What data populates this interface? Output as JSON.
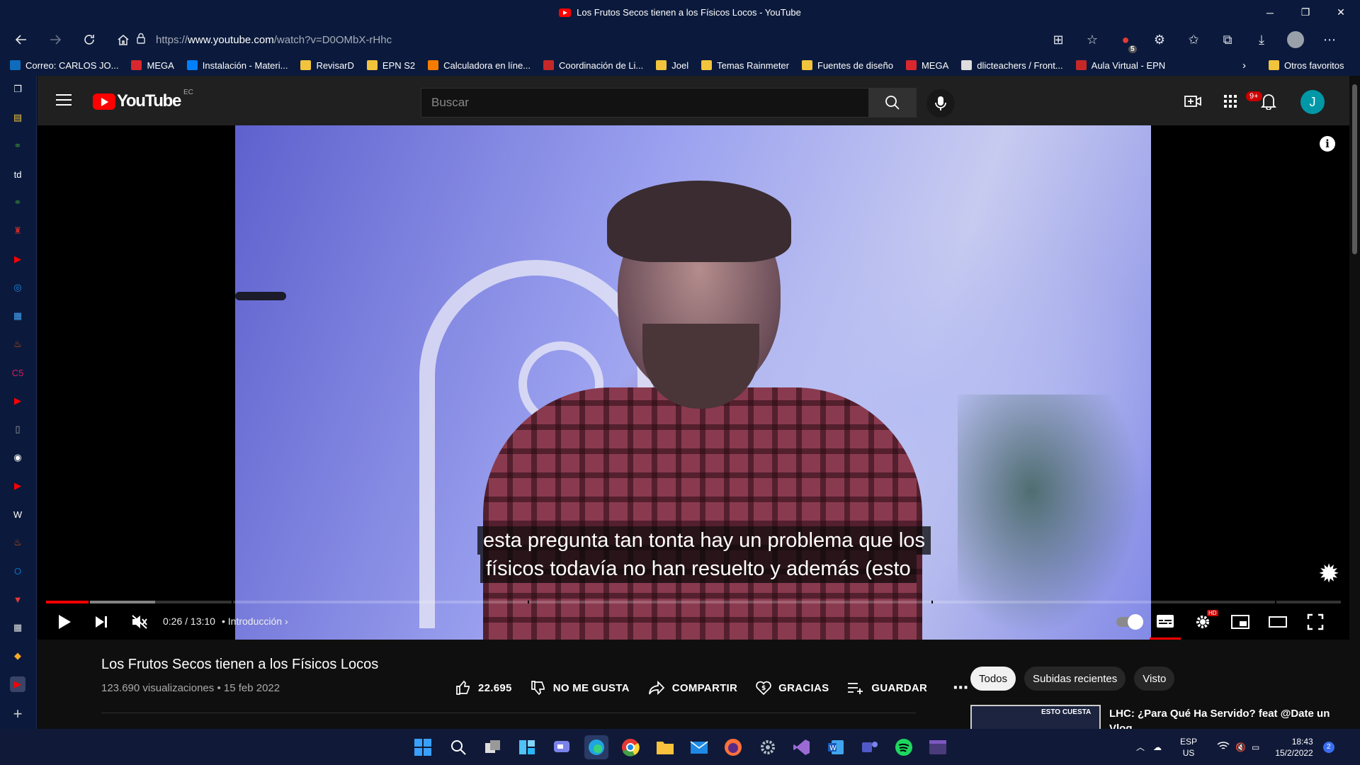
{
  "window": {
    "title": "Los Frutos Secos tienen a los Físicos Locos - YouTube",
    "controls": {
      "minimize": "─",
      "maximize": "❐",
      "close": "✕"
    }
  },
  "browser": {
    "url_prefix": "https://",
    "url_host": "www.youtube.com",
    "url_path": "/watch?v=D0OMbX-rHhc",
    "extension_badge": "5",
    "bookmarks": [
      {
        "label": "Correo: CARLOS JO...",
        "icon": "outlook-icon",
        "color": "#0f6cbd"
      },
      {
        "label": "MEGA",
        "icon": "mega-icon",
        "color": "#d9272e"
      },
      {
        "label": "Instalación - Materi...",
        "icon": "mui-icon",
        "color": "#007fff"
      },
      {
        "label": "RevisarD",
        "icon": "folder-icon",
        "color": "#f2c33d"
      },
      {
        "label": "EPN S2",
        "icon": "folder-icon",
        "color": "#f2c33d"
      },
      {
        "label": "Calculadora en líne...",
        "icon": "calculator-icon",
        "color": "#f57c00"
      },
      {
        "label": "Coordinación de Li...",
        "icon": "epn-icon",
        "color": "#c62828"
      },
      {
        "label": "Joel",
        "icon": "folder-icon",
        "color": "#f2c33d"
      },
      {
        "label": "Temas Rainmeter",
        "icon": "folder-icon",
        "color": "#f2c33d"
      },
      {
        "label": "Fuentes de diseño",
        "icon": "folder-icon",
        "color": "#f2c33d"
      },
      {
        "label": "MEGA",
        "icon": "mega-icon",
        "color": "#d9272e"
      },
      {
        "label": "dlicteachers / Front...",
        "icon": "pb-icon",
        "color": "#dddddd"
      },
      {
        "label": "Aula Virtual - EPN",
        "icon": "epn-icon",
        "color": "#c62828"
      }
    ],
    "other_favorites": "Otros favoritos"
  },
  "sidebar_icons": [
    {
      "name": "tabs-icon",
      "glyph": "❐",
      "color": "#ffffff"
    },
    {
      "name": "notes-icon",
      "glyph": "▤",
      "color": "#f2c33d"
    },
    {
      "name": "link-icon",
      "glyph": "⚭",
      "color": "#2e7d32"
    },
    {
      "name": "td-icon",
      "glyph": "td",
      "color": "#ffffff"
    },
    {
      "name": "link-icon-2",
      "glyph": "⚭",
      "color": "#2e7d32"
    },
    {
      "name": "game-icon",
      "glyph": "♜",
      "color": "#c62828"
    },
    {
      "name": "youtube-icon",
      "glyph": "▶",
      "color": "#ff0000"
    },
    {
      "name": "edge-icon",
      "glyph": "◎",
      "color": "#1e88e5"
    },
    {
      "name": "app-icon",
      "glyph": "▦",
      "color": "#42a5f5"
    },
    {
      "name": "java-icon",
      "glyph": "♨",
      "color": "#e65100"
    },
    {
      "name": "cs-icon",
      "glyph": "C5",
      "color": "#d81b60"
    },
    {
      "name": "youtube-icon-2",
      "glyph": "▶",
      "color": "#ff0000"
    },
    {
      "name": "doc-icon",
      "glyph": "▯",
      "color": "#9e9e9e"
    },
    {
      "name": "github-icon",
      "glyph": "◉",
      "color": "#ffffff"
    },
    {
      "name": "youtube-icon-3",
      "glyph": "▶",
      "color": "#ff0000"
    },
    {
      "name": "wordpress-icon",
      "glyph": "W",
      "color": "#ffffff"
    },
    {
      "name": "java-icon-2",
      "glyph": "♨",
      "color": "#e65100"
    },
    {
      "name": "outlook-icon",
      "glyph": "O",
      "color": "#0f6cbd"
    },
    {
      "name": "vivaldi-icon",
      "glyph": "▼",
      "color": "#e53935"
    },
    {
      "name": "calendar-icon",
      "glyph": "▦",
      "color": "#e0e0e0"
    },
    {
      "name": "pixel-icon",
      "glyph": "◆",
      "color": "#f9a825"
    },
    {
      "name": "youtube-icon-4",
      "glyph": "▶",
      "color": "#ff0000"
    },
    {
      "name": "add-icon",
      "glyph": "+",
      "color": "#cccccc"
    }
  ],
  "youtube": {
    "logo_text": "YouTube",
    "country_code": "EC",
    "search_placeholder": "Buscar",
    "notification_count": "9+",
    "avatar_letter": "J",
    "player": {
      "subtitle_line1": "esta pregunta tan tonta hay un problema que los",
      "subtitle_line2": "físicos todavía no han resuelto y además (esto",
      "time": "0:26 / 13:10",
      "chapter": "Introducción",
      "played_fraction": 0.033,
      "buffered_fraction": 0.084,
      "accent": "#ff0000"
    },
    "video": {
      "title": "Los Frutos Secos tienen a los Físicos Locos",
      "views": "123.690 visualizaciones",
      "date": "15 feb 2022",
      "likes": "22.695",
      "dislike_label": "NO ME GUSTA",
      "share_label": "COMPARTIR",
      "thanks_label": "GRACIAS",
      "save_label": "GUARDAR"
    },
    "chips": [
      "Todos",
      "Subidas recientes",
      "Visto"
    ],
    "recommendation": {
      "title": "LHC: ¿Para Qué Ha Servido? feat @Date un Vlog",
      "thumb_text": "ESTO CUESTA"
    }
  },
  "taskbar": {
    "language": "ESP",
    "layout": "US",
    "time": "18:43",
    "date": "15/2/2022"
  }
}
